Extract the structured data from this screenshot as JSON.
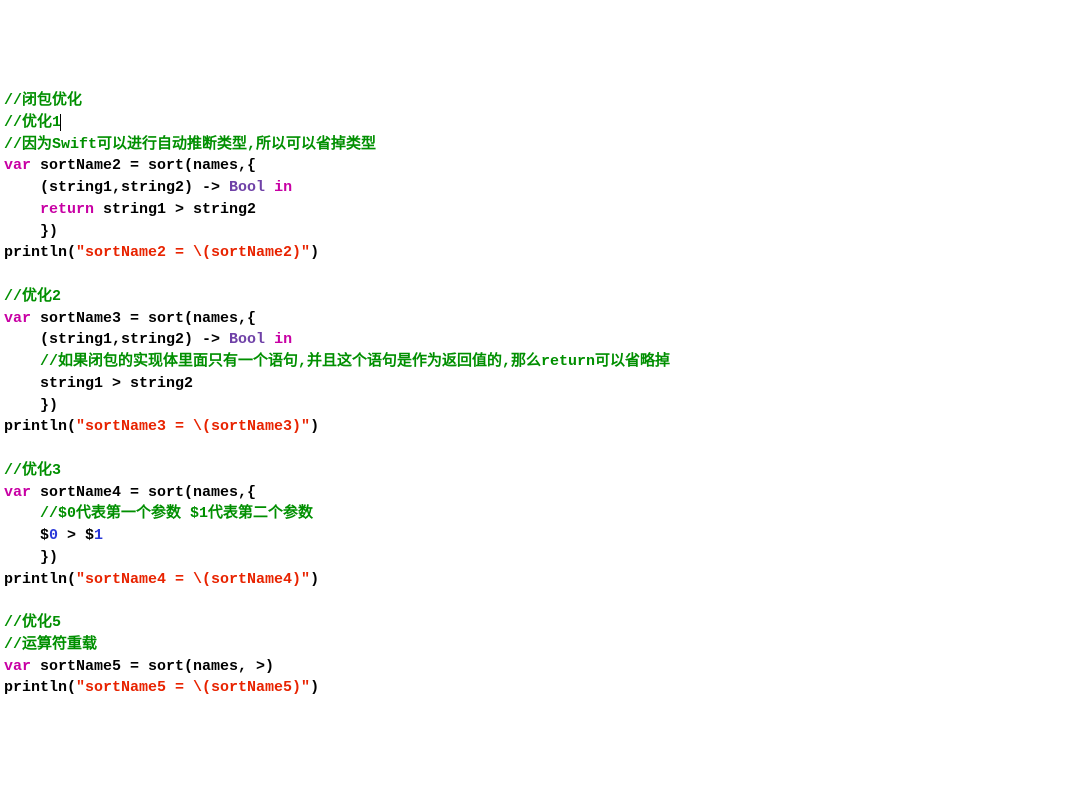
{
  "code": {
    "l1": "//闭包优化",
    "l2": "//优化1",
    "l3": "//因为Swift可以进行自动推断类型,所以可以省掉类型",
    "l4_kw": "var",
    "l4_rest": " sortName2 = sort(names,{",
    "l5": "    (string1,string2) -> ",
    "l5_type": "Bool",
    "l5_in": " in",
    "l6_kw": "    return",
    "l6_rest": " string1 > string2",
    "l7": "    })",
    "l8_fn": "println(",
    "l8_str": "\"sortName2 = \\(sortName2)\"",
    "l8_close": ")",
    "l10": "//优化2",
    "l11_kw": "var",
    "l11_rest": " sortName3 = sort(names,{",
    "l12": "    (string1,string2) -> ",
    "l12_type": "Bool",
    "l12_in": " in",
    "l13": "    //如果闭包的实现体里面只有一个语句,并且这个语句是作为返回值的,那么return可以省略掉",
    "l14": "    string1 > string2",
    "l15": "    })",
    "l16_fn": "println(",
    "l16_str": "\"sortName3 = \\(sortName3)\"",
    "l16_close": ")",
    "l18": "//优化3",
    "l19_kw": "var",
    "l19_rest": " sortName4 = sort(names,{",
    "l20": "    //$0代表第一个参数 $1代表第二个参数",
    "l21a": "    $",
    "l21n0": "0",
    "l21b": " > $",
    "l21n1": "1",
    "l22": "    })",
    "l23_fn": "println(",
    "l23_str": "\"sortName4 = \\(sortName4)\"",
    "l23_close": ")",
    "l25": "//优化5",
    "l26": "//运算符重载",
    "l27_kw": "var",
    "l27_rest": " sortName5 = sort(names, >)",
    "l28_fn": "println(",
    "l28_str": "\"sortName5 = \\(sortName5)\"",
    "l28_close": ")"
  }
}
